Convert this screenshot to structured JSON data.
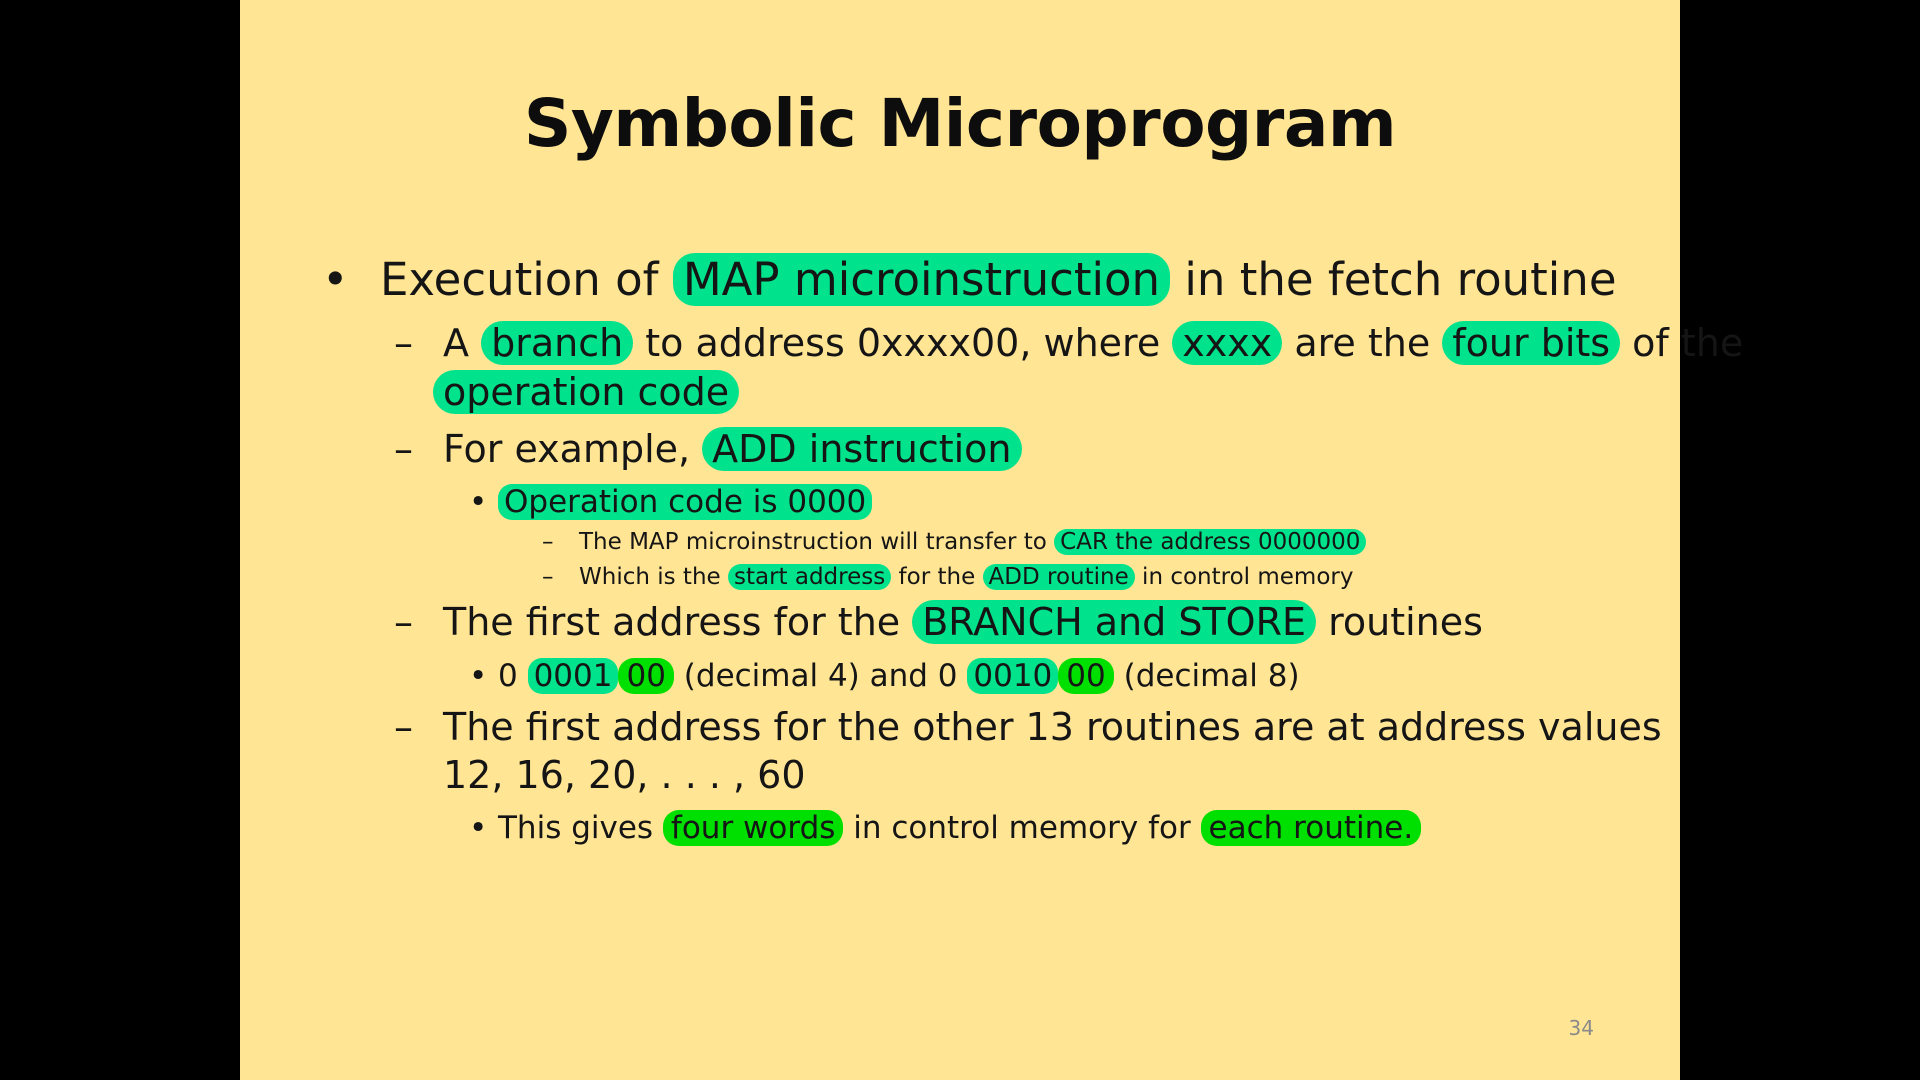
{
  "slide": {
    "title": "Symbolic Microprogram",
    "page_number": "34",
    "bullet_marker": "•",
    "dash_marker": "–",
    "lines": [
      {
        "parts": [
          "Execution of ",
          "MAP microinstruction",
          " in the fetch routine"
        ]
      },
      {
        "parts": [
          "A ",
          "branch",
          " to address 0xxxx00, where ",
          "xxxx",
          " are the ",
          "four bits",
          " of the"
        ]
      },
      {
        "parts": [
          "operation code"
        ]
      },
      {
        "parts": [
          "For example, ",
          "ADD instruction"
        ]
      },
      {
        "parts": [
          "Operation code is 0000"
        ]
      },
      {
        "parts": [
          "The MAP microinstruction will transfer to ",
          "CAR the address 0000000"
        ]
      },
      {
        "parts": [
          "Which is the ",
          "start address",
          " for the ",
          "ADD routine",
          " in control memory"
        ]
      },
      {
        "parts": [
          "The first address for the ",
          "BRANCH and STORE",
          " routines"
        ]
      },
      {
        "parts": [
          "0 ",
          "0001",
          "00",
          " (decimal 4) and 0 ",
          "0010",
          "00",
          " (decimal 8)"
        ]
      },
      {
        "parts": [
          "The first address for the other 13 routines are at address values"
        ]
      },
      {
        "parts": [
          "12, 16, 20, . . . , 60"
        ]
      },
      {
        "parts": [
          "This gives ",
          "four words",
          " in control memory for ",
          "each routine."
        ]
      }
    ]
  },
  "colors": {
    "slide_background": "#ffe594",
    "highlight_teal": "#00e38c",
    "highlight_green": "#00e000",
    "outer_background": "#000000"
  }
}
